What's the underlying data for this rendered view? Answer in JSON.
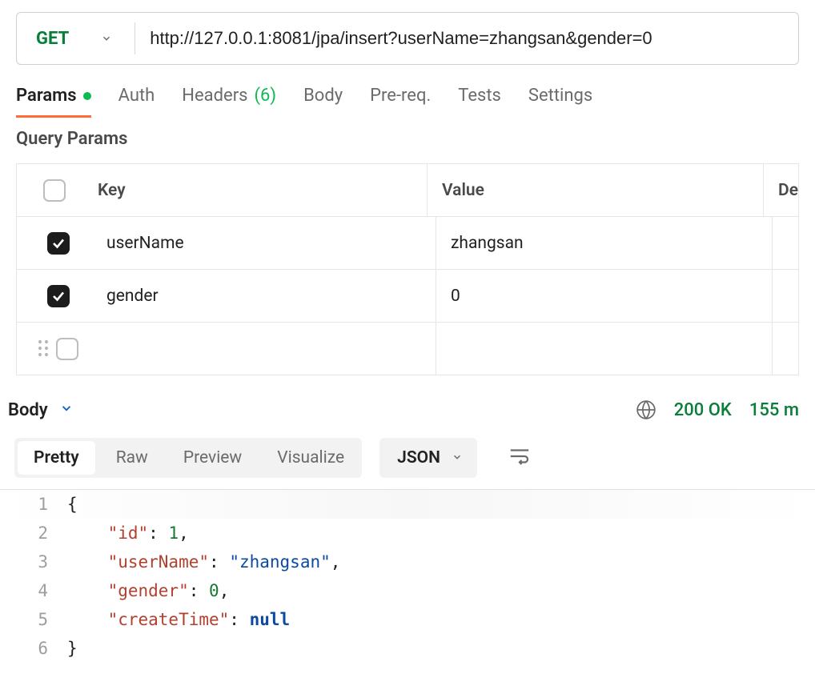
{
  "request": {
    "method": "GET",
    "url": "http://127.0.0.1:8081/jpa/insert?userName=zhangsan&gender=0"
  },
  "reqTabs": {
    "params": "Params",
    "auth": "Auth",
    "headers": "Headers",
    "headersCount": "(6)",
    "body": "Body",
    "prereq": "Pre-req.",
    "tests": "Tests",
    "settings": "Settings"
  },
  "sectionTitle": "Query Params",
  "paramsTable": {
    "headers": {
      "key": "Key",
      "value": "Value",
      "description": "De"
    },
    "rows": [
      {
        "checked": true,
        "key": "userName",
        "value": "zhangsan"
      },
      {
        "checked": true,
        "key": "gender",
        "value": "0"
      }
    ]
  },
  "response": {
    "label": "Body",
    "status": "200 OK",
    "time": "155 m"
  },
  "viewTabs": {
    "pretty": "Pretty",
    "raw": "Raw",
    "preview": "Preview",
    "visualize": "Visualize",
    "format": "JSON"
  },
  "responseBody": {
    "id_key": "\"id\"",
    "id_val": "1",
    "un_key": "\"userName\"",
    "un_val": "\"zhangsan\"",
    "g_key": "\"gender\"",
    "g_val": "0",
    "ct_key": "\"createTime\"",
    "ct_val": "null"
  }
}
